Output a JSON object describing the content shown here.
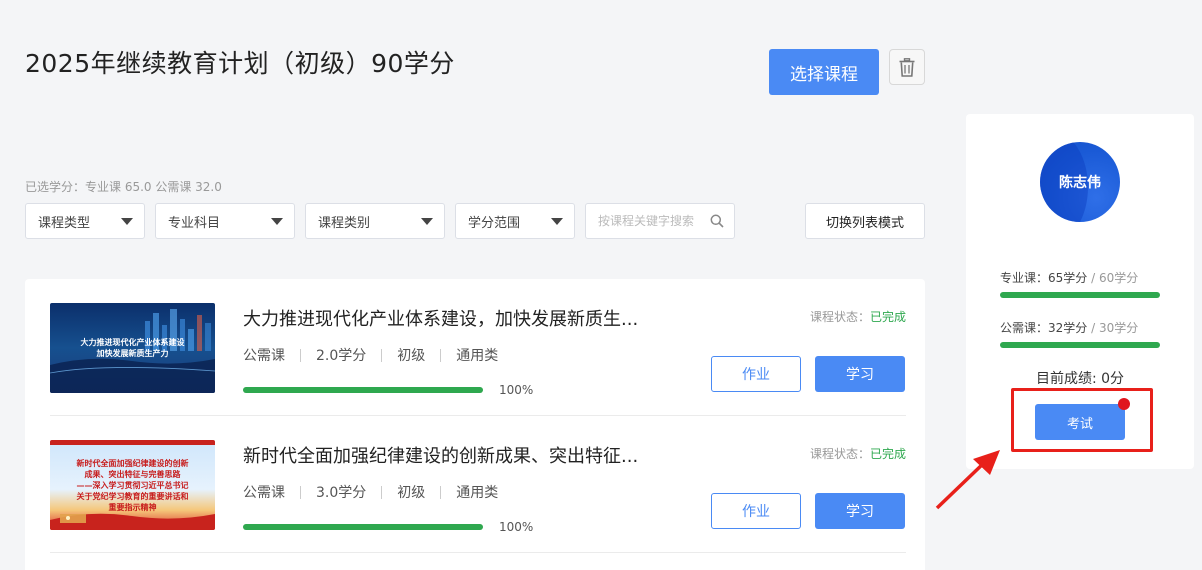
{
  "header": {
    "title": "2025年继续教育计划（初级）90学分",
    "select_course_label": "选择课程"
  },
  "credit_summary": "已选学分：专业课 65.0 公需课 32.0",
  "filters": {
    "course_type": "课程类型",
    "subject": "专业科目",
    "category": "课程类别",
    "credit_range": "学分范围",
    "search_placeholder": "按课程关键字搜索",
    "switch_label": "切换列表模式"
  },
  "courses": [
    {
      "title": "大力推进现代化产业体系建设，加快发展新质生...",
      "meta": [
        "公需课",
        "2.0学分",
        "初级",
        "通用类"
      ],
      "progress": 100,
      "progress_label": "100%",
      "status_label": "课程状态：",
      "status_value": "已完成",
      "homework_label": "作业",
      "study_label": "学习",
      "thumb_lines": [
        "大力推进现代化产业体系建设",
        "加快发展新质生产力"
      ]
    },
    {
      "title": "新时代全面加强纪律建设的创新成果、突出特征...",
      "meta": [
        "公需课",
        "3.0学分",
        "初级",
        "通用类"
      ],
      "progress": 100,
      "progress_label": "100%",
      "status_label": "课程状态：",
      "status_value": "已完成",
      "homework_label": "作业",
      "study_label": "学习",
      "thumb_lines": [
        "新时代全面加强纪律建设的创新",
        "成果、突出特征与完善思路",
        "——深入学习贯彻习近平总书记",
        "关于党纪学习教育的重要讲话和",
        "重要指示精神"
      ]
    }
  ],
  "sidebar": {
    "user_name": "陈志伟",
    "professional_label": "专业课：",
    "professional_earned": "65学分",
    "professional_required": "60学分",
    "public_label": "公需课：",
    "public_earned": "32学分",
    "public_required": "30学分",
    "score_label": "目前成绩: 0分",
    "exam_label": "考试"
  },
  "colors": {
    "primary": "#4a8af4",
    "success": "#2fa84f",
    "highlight": "#e8201a"
  },
  "icons": [
    "trash-icon",
    "caret-down-icon",
    "search-icon",
    "arrow-icon"
  ]
}
